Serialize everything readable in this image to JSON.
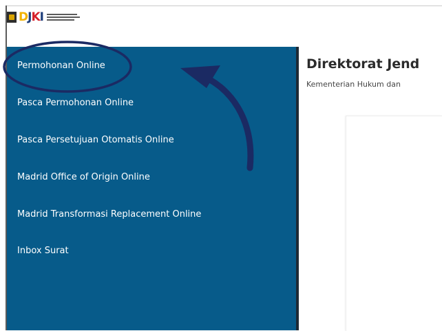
{
  "header": {
    "logo_text": "DJKI"
  },
  "sidebar": {
    "items": [
      {
        "label": "Permohonan Online"
      },
      {
        "label": "Pasca Permohonan Online"
      },
      {
        "label": "Pasca Persetujuan Otomatis Online"
      },
      {
        "label": "Madrid Office of Origin Online"
      },
      {
        "label": "Madrid Transformasi Replacement Online"
      },
      {
        "label": "Inbox Surat"
      }
    ]
  },
  "main": {
    "title": "Direktorat Jend",
    "subtitle": "Kementerian Hukum dan"
  },
  "annotation": {
    "color": "#1b2a63"
  }
}
